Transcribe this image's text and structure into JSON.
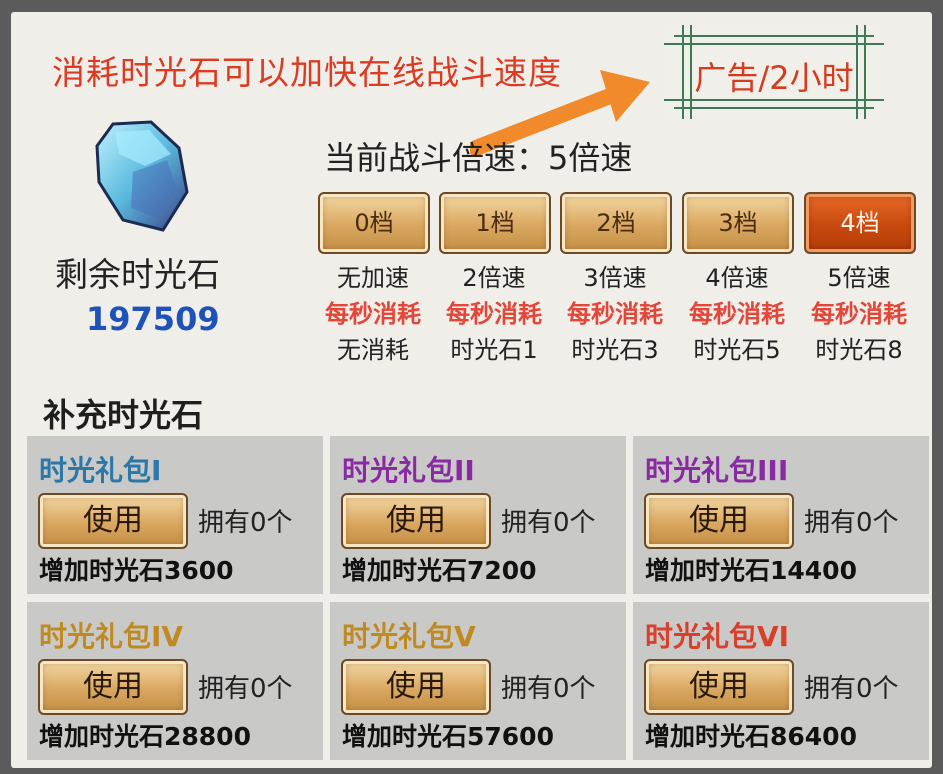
{
  "headline": "消耗时光石可以加快在线战斗速度",
  "ad_button": "广告/2小时",
  "remaining": {
    "label": "剩余时光石",
    "value": "197509"
  },
  "current_speed": "当前战斗倍速：5倍速",
  "tiers": [
    {
      "button": "0档",
      "speed": "无加速",
      "cost_label": "每秒消耗",
      "cost": "无消耗",
      "active": false
    },
    {
      "button": "1档",
      "speed": "2倍速",
      "cost_label": "每秒消耗",
      "cost": "时光石1",
      "active": false
    },
    {
      "button": "2档",
      "speed": "3倍速",
      "cost_label": "每秒消耗",
      "cost": "时光石3",
      "active": false
    },
    {
      "button": "3档",
      "speed": "4倍速",
      "cost_label": "每秒消耗",
      "cost": "时光石5",
      "active": false
    },
    {
      "button": "4档",
      "speed": "5倍速",
      "cost_label": "每秒消耗",
      "cost": "时光石8",
      "active": true
    }
  ],
  "section_title": "补充时光石",
  "packs": [
    {
      "name": "时光礼包I",
      "name_color": "#2a77a8",
      "use": "使用",
      "owned": "拥有0个",
      "gain": "增加时光石3600"
    },
    {
      "name": "时光礼包II",
      "name_color": "#8a2aa3",
      "use": "使用",
      "owned": "拥有0个",
      "gain": "增加时光石7200"
    },
    {
      "name": "时光礼包III",
      "name_color": "#8a2aa3",
      "use": "使用",
      "owned": "拥有0个",
      "gain": "增加时光石14400"
    },
    {
      "name": "时光礼包IV",
      "name_color": "#c08a22",
      "use": "使用",
      "owned": "拥有0个",
      "gain": "增加时光石28800"
    },
    {
      "name": "时光礼包V",
      "name_color": "#c08a22",
      "use": "使用",
      "owned": "拥有0个",
      "gain": "增加时光石57600"
    },
    {
      "name": "时光礼包VI",
      "name_color": "#d8402c",
      "use": "使用",
      "owned": "拥有0个",
      "gain": "增加时光石86400"
    }
  ],
  "icons": {
    "gem": "time-stone-icon",
    "arrow": "orange-arrow-icon"
  }
}
